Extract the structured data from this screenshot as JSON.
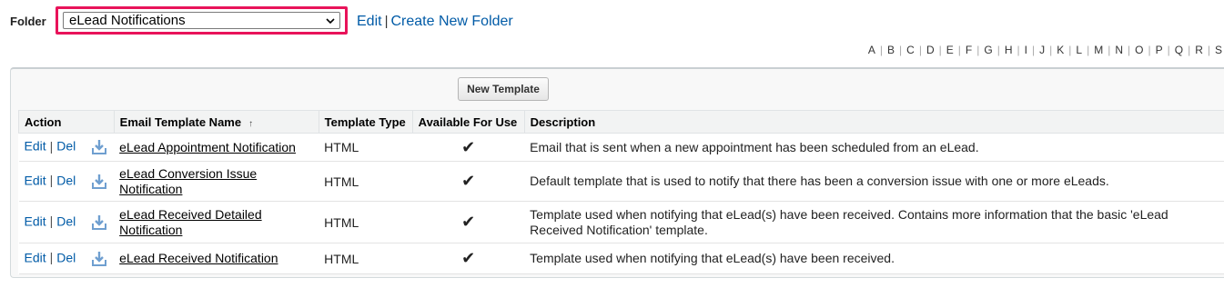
{
  "folder": {
    "label": "Folder",
    "selected": "eLead Notifications",
    "edit_link": "Edit",
    "separator": "|",
    "create_link": "Create New Folder"
  },
  "alphabet": [
    "A",
    "B",
    "C",
    "D",
    "E",
    "F",
    "G",
    "H",
    "I",
    "J",
    "K",
    "L",
    "M",
    "N",
    "O",
    "P",
    "Q",
    "R",
    "S"
  ],
  "toolbar": {
    "new_template": "New Template"
  },
  "table": {
    "headers": {
      "action": "Action",
      "name": "Email Template Name",
      "sort_indicator": "↑",
      "type": "Template Type",
      "available": "Available For Use",
      "description": "Description"
    },
    "action_labels": {
      "edit": "Edit",
      "separator": "|",
      "del": "Del"
    },
    "rows": [
      {
        "name": "eLead Appointment Notification",
        "type": "HTML",
        "available": "✔",
        "description": "Email that is sent when a new appointment has been scheduled from an eLead."
      },
      {
        "name": "eLead Conversion Issue Notification",
        "type": "HTML",
        "available": "✔",
        "description": "Default template that is used to notify that there has been a conversion issue with one or more eLeads."
      },
      {
        "name": "eLead Received Detailed Notification",
        "type": "HTML",
        "available": "✔",
        "description": "Template used when notifying that eLead(s) have been received. Contains more information that the basic 'eLead Received Notification' template."
      },
      {
        "name": "eLead Received Notification",
        "type": "HTML",
        "available": "✔",
        "description": "Template used when notifying that eLead(s) have been received."
      }
    ]
  },
  "colors": {
    "highlight_border": "#e8135a",
    "link": "#015ba7"
  },
  "icons": {
    "download": "download-icon",
    "dropdown": "chevron-down-icon"
  }
}
